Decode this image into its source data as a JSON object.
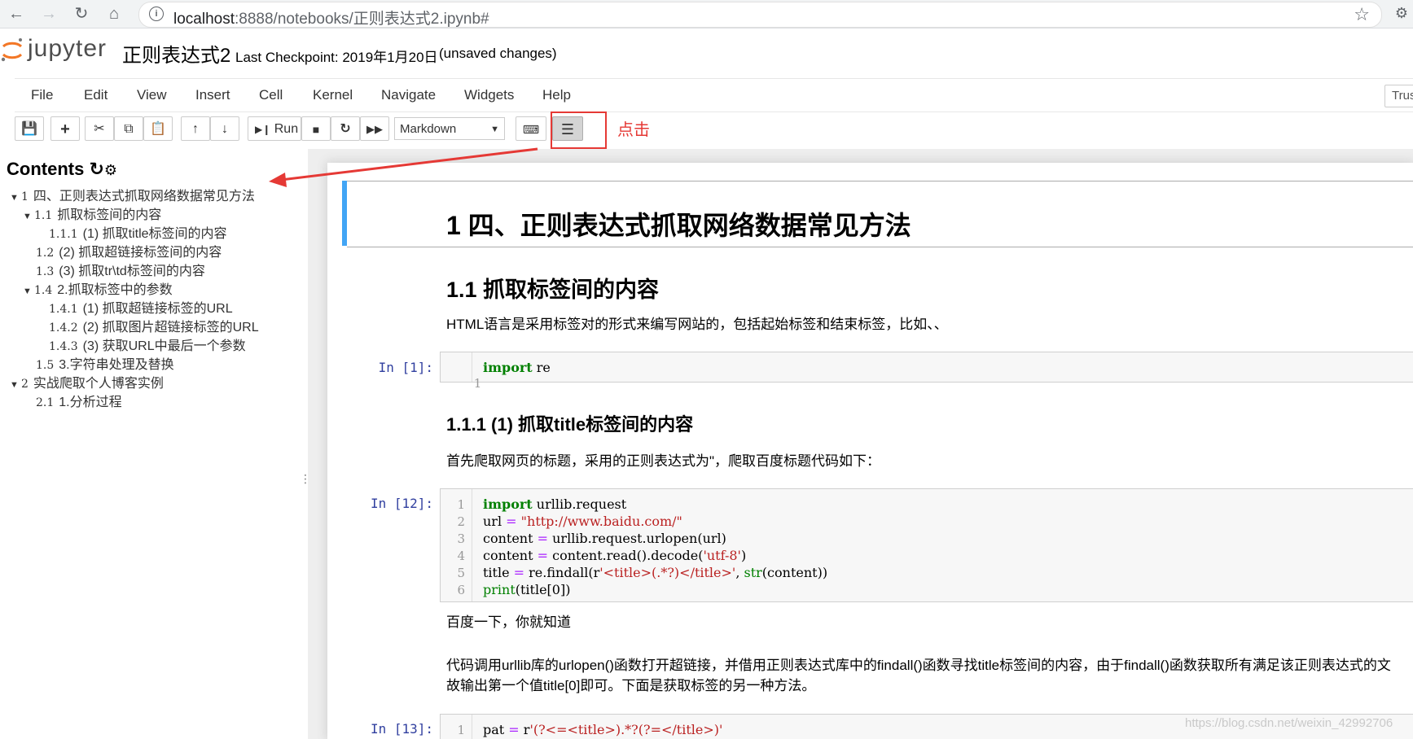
{
  "browser": {
    "url_prefix": "localhost",
    "url_rest": ":8888/notebooks/正则表达式2.ipynb#"
  },
  "header": {
    "logo_text": "jupyter",
    "notebook_name": "正则表达式2",
    "checkpoint": "Last Checkpoint: 2019年1月20日",
    "status": "(unsaved changes)"
  },
  "menu": {
    "items": [
      "File",
      "Edit",
      "View",
      "Insert",
      "Cell",
      "Kernel",
      "Navigate",
      "Widgets",
      "Help"
    ],
    "trusted": "Trus"
  },
  "toolbar": {
    "run_label": "Run",
    "cell_type": "Markdown"
  },
  "annotation": {
    "click_note": "点击"
  },
  "toc": {
    "title": "Contents",
    "items": [
      {
        "num": "1",
        "label": "四、正则表达式抓取网络数据常见方法",
        "expanded": true
      },
      {
        "num": "1.1",
        "label": "抓取标签间的内容",
        "expanded": true
      },
      {
        "num": "1.1.1",
        "label": "(1) 抓取title标签间的内容"
      },
      {
        "num": "1.2",
        "label": "(2) 抓取超链接标签间的内容"
      },
      {
        "num": "1.3",
        "label": "(3) 抓取tr\\td标签间的内容"
      },
      {
        "num": "1.4",
        "label": "2.抓取标签中的参数",
        "expanded": true
      },
      {
        "num": "1.4.1",
        "label": "(1) 抓取超链接标签的URL"
      },
      {
        "num": "1.4.2",
        "label": "(2) 抓取图片超链接标签的URL"
      },
      {
        "num": "1.4.3",
        "label": "(3) 获取URL中最后一个参数"
      },
      {
        "num": "1.5",
        "label": "3.字符串处理及替换"
      },
      {
        "num": "2",
        "label": "实战爬取个人博客实例",
        "expanded": true
      },
      {
        "num": "2.1",
        "label": "1.分析过程"
      }
    ]
  },
  "notebook": {
    "h1": "1  四、正则表达式抓取网络数据常见方法",
    "h2": "1.1  抓取标签间的内容",
    "p1": "HTML语言是采用标签对的形式来编写网站的，包括起始标签和结束标签，比如、、",
    "cell1": {
      "prompt": "In  [1]:",
      "lines": [
        {
          "n": "1",
          "kw": "import",
          "rest": " re"
        }
      ]
    },
    "h3": "1.1.1  (1) 抓取title标签间的内容",
    "p2": "首先爬取网页的标题，采用的正则表达式为\"，爬取百度标题代码如下：",
    "cell2": {
      "prompt": "In  [12]:",
      "line_numbers": [
        "1",
        "2",
        "3",
        "4",
        "5",
        "6"
      ]
    },
    "output": "百度一下，你就知道",
    "p3a": "代码调用urllib库的urlopen()函数打开超链接，并借用正则表达式库中的findall()函数寻找title标签间的内容，由于findall()函数获取所有满足该正则表达式的文",
    "p3b": "故输出第一个值title[0]即可。下面是获取标签的另一种方法。",
    "cell3": {
      "prompt": "In  [13]:",
      "line": "1"
    }
  },
  "watermark": "https://blog.csdn.net/weixin_42992706",
  "colors": {
    "accent": "#42a5f5",
    "annotation": "#e53935",
    "prompt": "#303f9f"
  }
}
